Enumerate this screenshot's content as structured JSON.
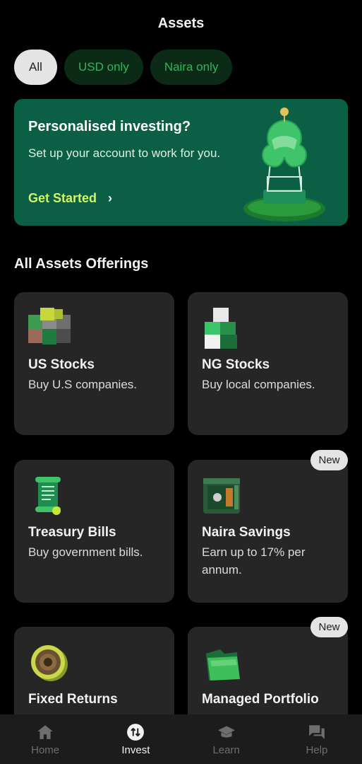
{
  "header": {
    "title": "Assets"
  },
  "filters": [
    {
      "label": "All",
      "active": true
    },
    {
      "label": "USD only",
      "active": false
    },
    {
      "label": "Naira only",
      "active": false
    }
  ],
  "promo": {
    "title": "Personalised investing?",
    "subtitle": "Set up your account to work for you.",
    "cta": "Get Started"
  },
  "section": {
    "title": "All Assets Offerings"
  },
  "cards": [
    {
      "title": "US Stocks",
      "desc": "Buy U.S companies.",
      "icon": "us-stocks-cubes-icon",
      "badge": ""
    },
    {
      "title": "NG Stocks",
      "desc": "Buy local companies.",
      "icon": "ng-stocks-cubes-icon",
      "badge": ""
    },
    {
      "title": "Treasury Bills",
      "desc": "Buy government bills.",
      "icon": "scroll-icon",
      "badge": ""
    },
    {
      "title": "Naira Savings",
      "desc": "Earn up to 17% per annum.",
      "icon": "safe-icon",
      "badge": "New"
    },
    {
      "title": "Fixed Returns",
      "desc": "",
      "icon": "coin-icon",
      "badge": ""
    },
    {
      "title": "Managed Portfolio",
      "desc": "",
      "icon": "folder-icon",
      "badge": "New"
    }
  ],
  "nav": [
    {
      "label": "Home",
      "icon": "home-icon",
      "active": false
    },
    {
      "label": "Invest",
      "icon": "invest-icon",
      "active": true
    },
    {
      "label": "Learn",
      "icon": "graduation-cap-icon",
      "active": false
    },
    {
      "label": "Help",
      "icon": "chat-bubbles-icon",
      "active": false
    }
  ],
  "colors": {
    "background": "#000000",
    "card": "#262626",
    "promo": "#0b5f45",
    "accent_green": "#2fb55a",
    "cta_lime": "#d6f565"
  }
}
